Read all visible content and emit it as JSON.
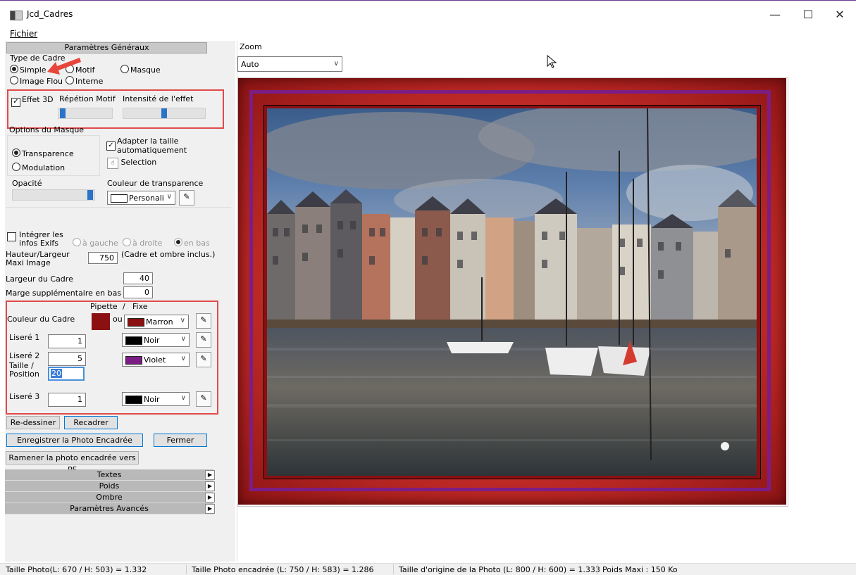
{
  "window": {
    "title": "Jcd_Cadres",
    "minimize": "—",
    "maximize": "☐",
    "close": "✕"
  },
  "menu": {
    "file": "Fichier"
  },
  "general": {
    "header": "Paramètres Généraux",
    "frame_type_label": "Type de Cadre",
    "types": [
      "Simple",
      "Motif",
      "Masque",
      "Image Flou",
      "Interne"
    ],
    "effect3d_label": "Effet 3D",
    "repeat_label": "Répétion Motif",
    "intensity_label": "Intensité de l'effet"
  },
  "mask": {
    "header": "Options du Masque",
    "transparency": "Transparence",
    "modulation": "Modulation",
    "auto_size": "Adapter la taille automatiquement",
    "selection": "Selection",
    "opacity": "Opacité",
    "transparency_color_label": "Couleur de transparence",
    "transparency_color_value": "Personali"
  },
  "exif": {
    "label": "Intégrer les infos Exifs",
    "left": "à gauche",
    "right": "à droite",
    "bottom": "en bas"
  },
  "dims": {
    "max_label": "Hauteur/Largeur Maxi Image",
    "max_value": "750",
    "max_note": "(Cadre et ombre inclus.)",
    "frame_width_label": "Largeur du Cadre",
    "frame_width_value": "40",
    "extra_margin_label": "Marge supplémentaire en bas",
    "extra_margin_value": "0"
  },
  "colors": {
    "pipette": "Pipette",
    "slash": "/",
    "fixe": "Fixe",
    "frame_color_label": "Couleur du Cadre",
    "ou": "ou",
    "frame_color": "#8b1012",
    "frame_color_name": "Marron",
    "lisere1_label": "Liseré 1",
    "lisere1_value": "1",
    "lisere1_color_name": "Noir",
    "lisere2_label": "Liseré 2",
    "lisere2_value": "5",
    "lisere2_color_name": "Violet",
    "size_label": "Taille / Position",
    "size_value": "20",
    "lisere3_label": "Liseré 3",
    "lisere3_value": "1",
    "lisere3_color_name": "Noir",
    "black": "#000000",
    "violet": "#7b1d85"
  },
  "buttons": {
    "redraw": "Re-dessiner",
    "reframe": "Recadrer",
    "save": "Enregistrer la Photo Encadrée",
    "close": "Fermer",
    "return": "Ramener la photo encadrée vers PF"
  },
  "sections": [
    "Textes",
    "Poids",
    "Ombre",
    "Paramètres Avancés"
  ],
  "zoom": {
    "label": "Zoom",
    "value": "Auto"
  },
  "status": {
    "photo": "Taille Photo(L: 670 / H: 503) = 1.332",
    "framed": "Taille Photo encadrée (L: 750 / H: 583) = 1.286",
    "original": "Taille d'origine de la Photo (L: 800 / H: 600) = 1.333",
    "weight": "Poids Maxi : 150 Ko"
  }
}
